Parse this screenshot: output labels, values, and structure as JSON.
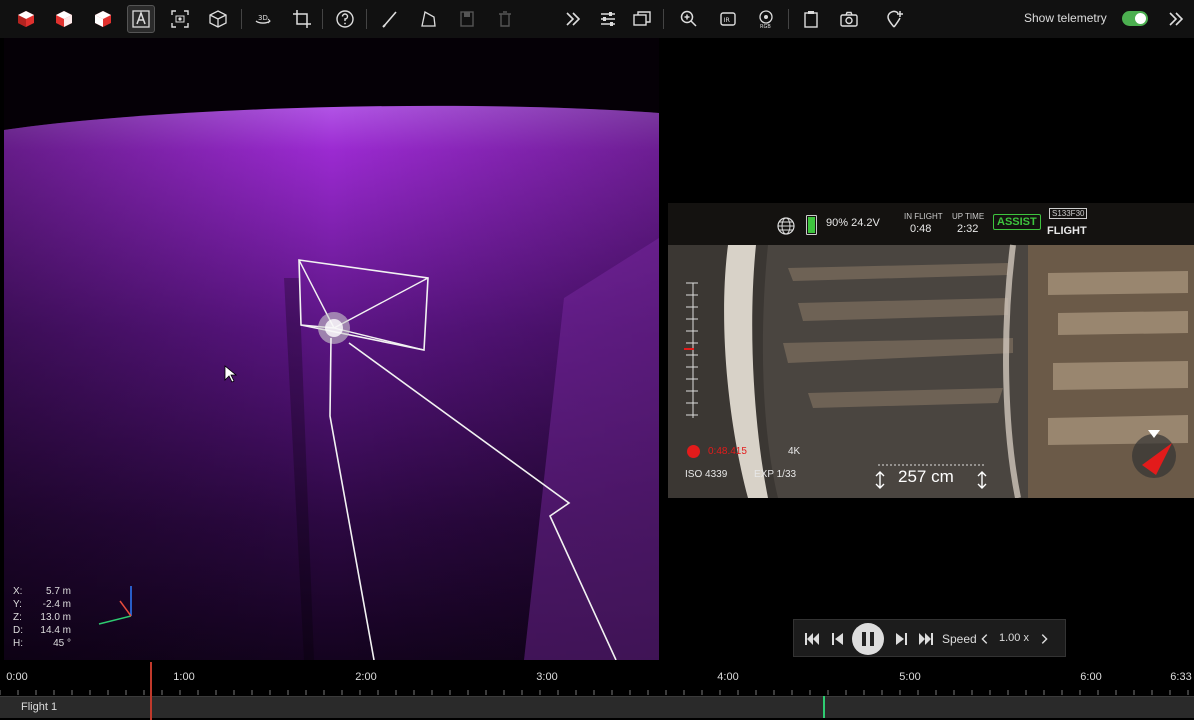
{
  "toolbar": {
    "buttons": [
      {
        "name": "cube-red-icon",
        "icon": "cube-red-icon"
      },
      {
        "name": "cube-red-half-icon",
        "icon": "cube-red-half-icon"
      },
      {
        "name": "cube-red-outline-icon",
        "icon": "cube-red-outline-icon"
      },
      {
        "name": "text-annotation-icon",
        "icon": "text-annotation-icon"
      },
      {
        "name": "camera-frame-icon",
        "icon": "camera-frame-icon"
      },
      {
        "name": "cube-wireframe-icon",
        "icon": "cube-wireframe-icon"
      },
      {
        "name": "3d-rotate-icon",
        "icon": "3d-rotate-icon"
      },
      {
        "name": "crop-icon",
        "icon": "crop-icon"
      },
      {
        "name": "help-icon",
        "icon": "help-icon"
      },
      {
        "name": "ruler-icon",
        "icon": "ruler-icon"
      },
      {
        "name": "polygon-icon",
        "icon": "polygon-icon"
      },
      {
        "name": "save-icon",
        "icon": "save-icon"
      },
      {
        "name": "trash-icon",
        "icon": "trash-icon"
      },
      {
        "name": "double-chevron-right-icon",
        "icon": "double-chevron-right-icon"
      },
      {
        "name": "sliders-icon",
        "icon": "sliders-icon"
      },
      {
        "name": "windows-icon",
        "icon": "windows-icon"
      },
      {
        "name": "zoom-in-icon",
        "icon": "zoom-in-icon"
      },
      {
        "name": "ir-camera-icon",
        "icon": "ir-camera-icon"
      },
      {
        "name": "rgb-icon",
        "icon": "rgb-icon"
      },
      {
        "name": "clipboard-icon",
        "icon": "clipboard-icon"
      },
      {
        "name": "camera-icon",
        "icon": "camera-icon"
      },
      {
        "name": "add-poi-icon",
        "icon": "add-poi-icon"
      }
    ],
    "telemetry_label": "Show telemetry",
    "telemetry_on": true
  },
  "viewport": {
    "coords": [
      {
        "key": "X:",
        "value": "5.7 m"
      },
      {
        "key": "Y:",
        "value": "-2.4 m"
      },
      {
        "key": "Z:",
        "value": "13.0 m"
      },
      {
        "key": "D:",
        "value": "14.4 m"
      },
      {
        "key": "H:",
        "value": "45 °"
      }
    ]
  },
  "camera_hud": {
    "battery_text": "90%  24.2V",
    "battery_level": 0.9,
    "in_flight_label": "IN FLIGHT",
    "in_flight_time": "0:48",
    "up_time_label": "UP TIME",
    "up_time": "2:32",
    "assist_label": "ASSIST",
    "mode_code": "S133F30",
    "mode_label": "FLIGHT",
    "rec_time": "0:48.415",
    "resolution": "4K",
    "iso": "ISO 4339",
    "exposure": "EXP 1/33",
    "distance": "257 cm"
  },
  "playback": {
    "speed_label": "Speed",
    "speed_value": "1.00 x"
  },
  "timeline": {
    "ticks": [
      {
        "label": "0:00"
      },
      {
        "label": "1:00"
      },
      {
        "label": "2:00"
      },
      {
        "label": "3:00"
      },
      {
        "label": "4:00"
      },
      {
        "label": "5:00"
      },
      {
        "label": "6:00"
      },
      {
        "label": "6:33"
      }
    ],
    "track_label": "Flight 1"
  },
  "colors": {
    "accent_green": "#3ec43e",
    "record_red": "#e31b1b",
    "pointcloud_purple": "#8a1fb4"
  }
}
